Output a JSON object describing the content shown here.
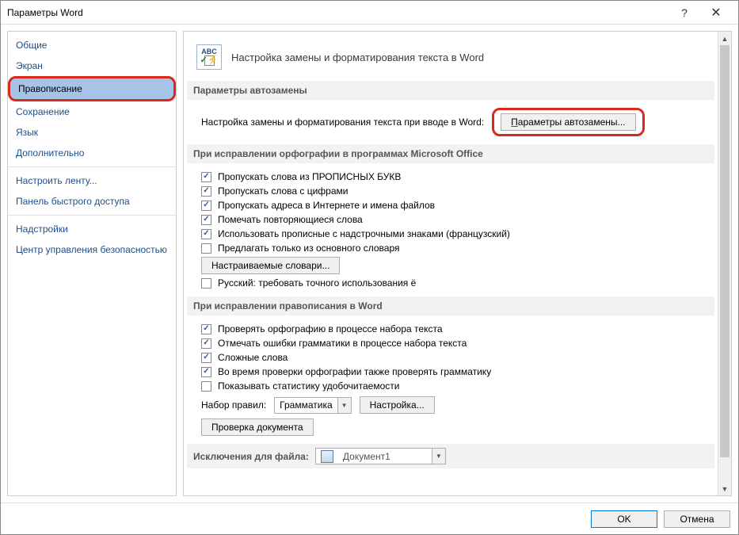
{
  "title": "Параметры Word",
  "sidebar": {
    "items": [
      {
        "label": "Общие"
      },
      {
        "label": "Экран"
      },
      {
        "label": "Правописание",
        "selected": true,
        "highlight": true
      },
      {
        "label": "Сохранение"
      },
      {
        "label": "Язык"
      },
      {
        "label": "Дополнительно"
      },
      {
        "label": "Настроить ленту..."
      },
      {
        "label": "Панель быстрого доступа"
      },
      {
        "label": "Надстройки"
      },
      {
        "label": "Центр управления безопасностью"
      }
    ]
  },
  "header": {
    "title": "Настройка замены и форматирования текста в Word"
  },
  "section1": {
    "title": "Параметры автозамены",
    "desc": "Настройка замены и форматирования текста при вводе в Word:",
    "button": "Параметры автозамены..."
  },
  "section2": {
    "title": "При исправлении орфографии в программах Microsoft Office",
    "c1": "Пропускать слова из ПРОПИСНЫХ БУКВ",
    "c2": "Пропускать слова с цифрами",
    "c3": "Пропускать адреса в Интернете и имена файлов",
    "c4": "Помечать повторяющиеся слова",
    "c5": "Использовать прописные с надстрочными знаками (французский)",
    "c6": "Предлагать только из основного словаря",
    "btn": "Настраиваемые словари...",
    "c7": "Русский: требовать точного использования ё"
  },
  "section3": {
    "title": "При исправлении правописания в Word",
    "c1": "Проверять орфографию в процессе набора текста",
    "c2": "Отмечать ошибки грамматики в процессе набора текста",
    "c3": "Сложные слова",
    "c4": "Во время проверки орфографии также проверять грамматику",
    "c5": "Показывать статистику удобочитаемости",
    "ruleset_label": "Набор правил:",
    "ruleset_value": "Грамматика",
    "settings_btn": "Настройка...",
    "check_btn": "Проверка документа"
  },
  "section4": {
    "title": "Исключения для файла:",
    "value": "Документ1"
  },
  "footer": {
    "ok": "OK",
    "cancel": "Отмена"
  }
}
